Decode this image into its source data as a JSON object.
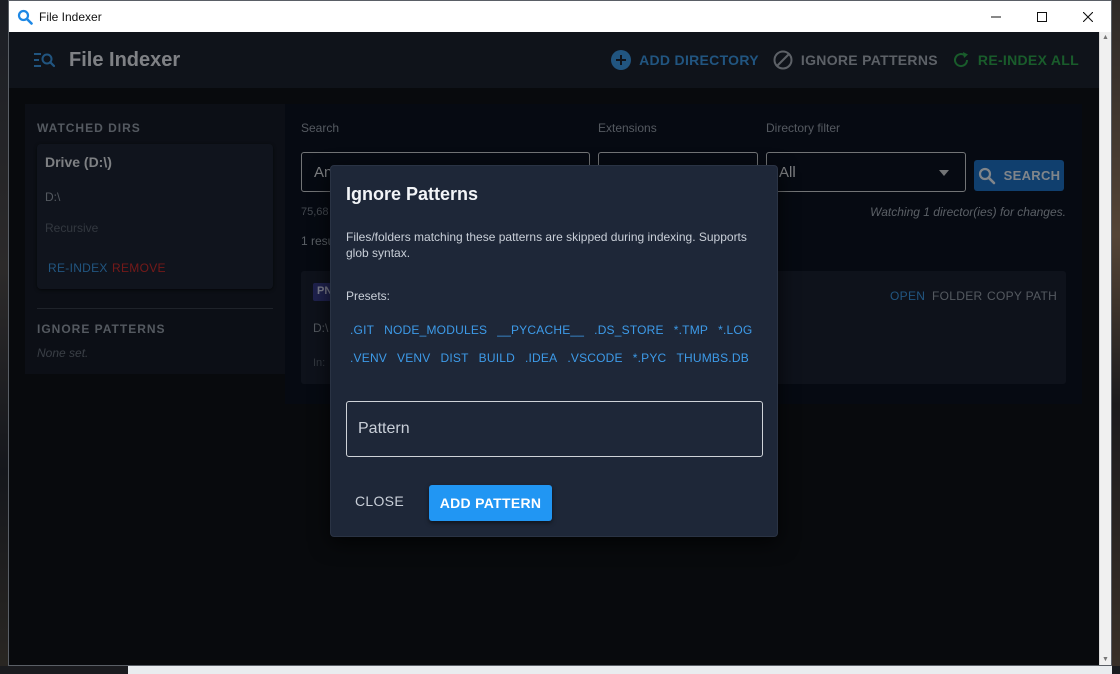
{
  "window": {
    "title": "File Indexer"
  },
  "header": {
    "title": "File Indexer",
    "add_directory": "ADD DIRECTORY",
    "ignore_patterns": "IGNORE PATTERNS",
    "reindex_all": "RE-INDEX ALL"
  },
  "sidebar": {
    "watched_heading": "WATCHED DIRS",
    "dir": {
      "name": "Drive (D:\\)",
      "path": "D:\\",
      "mode": "Recursive",
      "reindex": "RE-INDEX",
      "remove": "REMOVE"
    },
    "ignore_heading": "IGNORE PATTERNS",
    "ignore_empty": "None set."
  },
  "main": {
    "search_label": "Search",
    "search_value": "An",
    "extensions_label": "Extensions",
    "dir_filter_label": "Directory filter",
    "dir_filter_value": "All",
    "search_button": "SEARCH",
    "stat_text": "75,68",
    "watching_text": "Watching 1 director(ies) for changes.",
    "count_text": "1 resu",
    "result": {
      "badge": "PN",
      "path": "D:\\",
      "in_text": "In:",
      "open": "OPEN",
      "folder": "FOLDER",
      "copy_path": "COPY PATH"
    }
  },
  "dialog": {
    "title": "Ignore Patterns",
    "description": "Files/folders matching these patterns are skipped during indexing. Supports glob syntax.",
    "presets_label": "Presets:",
    "presets_row1": [
      ".GIT",
      "NODE_MODULES",
      "__PYCACHE__",
      ".DS_STORE",
      "*.TMP",
      "*.LOG"
    ],
    "presets_row2": [
      ".VENV",
      "VENV",
      "DIST",
      "BUILD",
      ".IDEA",
      ".VSCODE",
      "*.PYC",
      "THUMBS.DB"
    ],
    "pattern_placeholder": "Pattern",
    "close": "CLOSE",
    "add_pattern": "ADD PATTERN"
  },
  "colors": {
    "accent_blue": "#3d9be9",
    "primary_button": "#2196f3",
    "success_green": "#2fa84f",
    "danger_red": "#d32f2f"
  }
}
